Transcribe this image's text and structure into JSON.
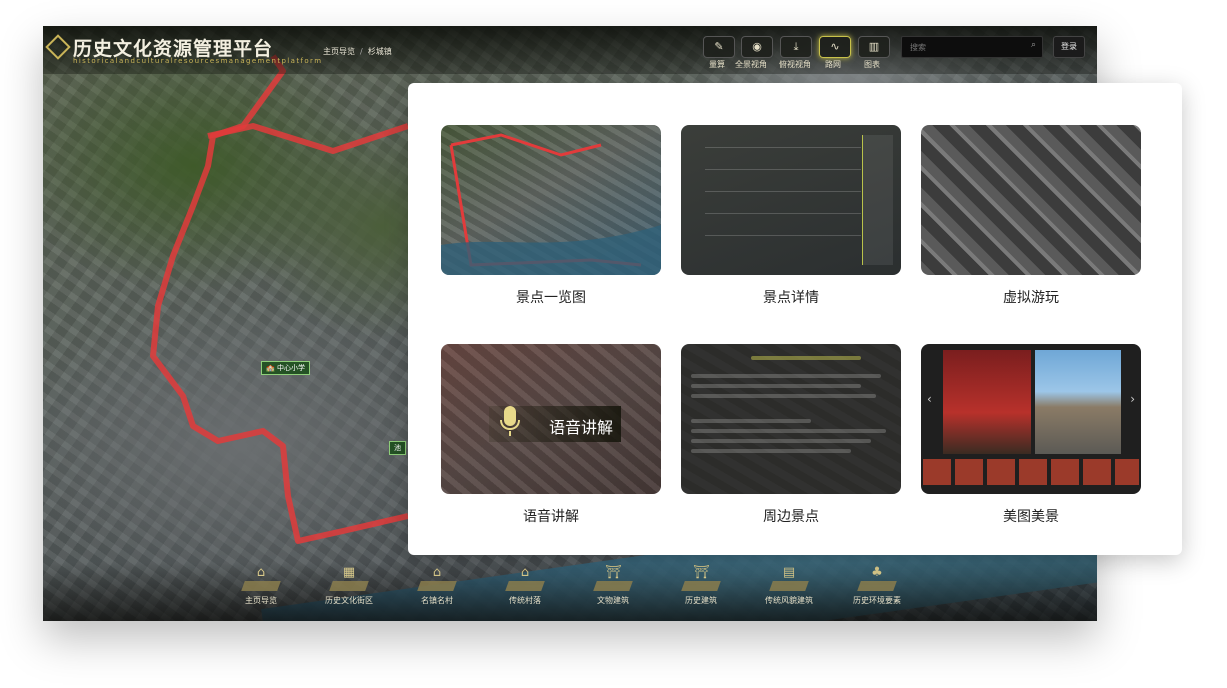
{
  "header": {
    "title": "历史文化资源管理平台",
    "subtitle": "historicalandculturalresourcesmanagementplatform",
    "breadcrumb": [
      "主页导览",
      "杉城镇"
    ]
  },
  "toolbar": {
    "tools": [
      {
        "label": "量算",
        "icon": "ruler-icon",
        "glyph": "✎",
        "active": false
      },
      {
        "label": "全景视角",
        "icon": "compass-icon",
        "glyph": "◉",
        "active": false
      },
      {
        "label": "俯视视角",
        "icon": "download-view-icon",
        "glyph": "⤓",
        "active": false
      },
      {
        "label": "路网",
        "icon": "route-icon",
        "glyph": "∿",
        "active": true
      },
      {
        "label": "图表",
        "icon": "bar-chart-icon",
        "glyph": "▥",
        "active": false
      }
    ],
    "search_placeholder": "搜索",
    "login_label": "登录"
  },
  "map": {
    "markers": [
      {
        "label": "中心小学"
      },
      {
        "label": "池"
      }
    ],
    "route_color": "#e23b3b"
  },
  "bottom_nav": [
    {
      "label": "主页导览",
      "icon": "home-pin-icon",
      "glyph": "⌂"
    },
    {
      "label": "历史文化街区",
      "icon": "district-icon",
      "glyph": "▦"
    },
    {
      "label": "名镇名村",
      "icon": "town-icon",
      "glyph": "⌂"
    },
    {
      "label": "传统村落",
      "icon": "village-icon",
      "glyph": "⌂"
    },
    {
      "label": "文物建筑",
      "icon": "heritage-building-icon",
      "glyph": "⛩"
    },
    {
      "label": "历史建筑",
      "icon": "historic-building-icon",
      "glyph": "⛩"
    },
    {
      "label": "传统风貌建筑",
      "icon": "traditional-building-icon",
      "glyph": "▤"
    },
    {
      "label": "历史环境要素",
      "icon": "environment-element-icon",
      "glyph": "♣"
    }
  ],
  "features": [
    {
      "label": "景点一览图"
    },
    {
      "label": "景点详情"
    },
    {
      "label": "虚拟游玩"
    },
    {
      "label": "语音讲解",
      "badge": "语音讲解"
    },
    {
      "label": "周边景点"
    },
    {
      "label": "美图美景"
    }
  ],
  "colors": {
    "accent_gold": "#c9b458",
    "active_glow": "#c9c24a",
    "card_bg": "#ffffff"
  }
}
